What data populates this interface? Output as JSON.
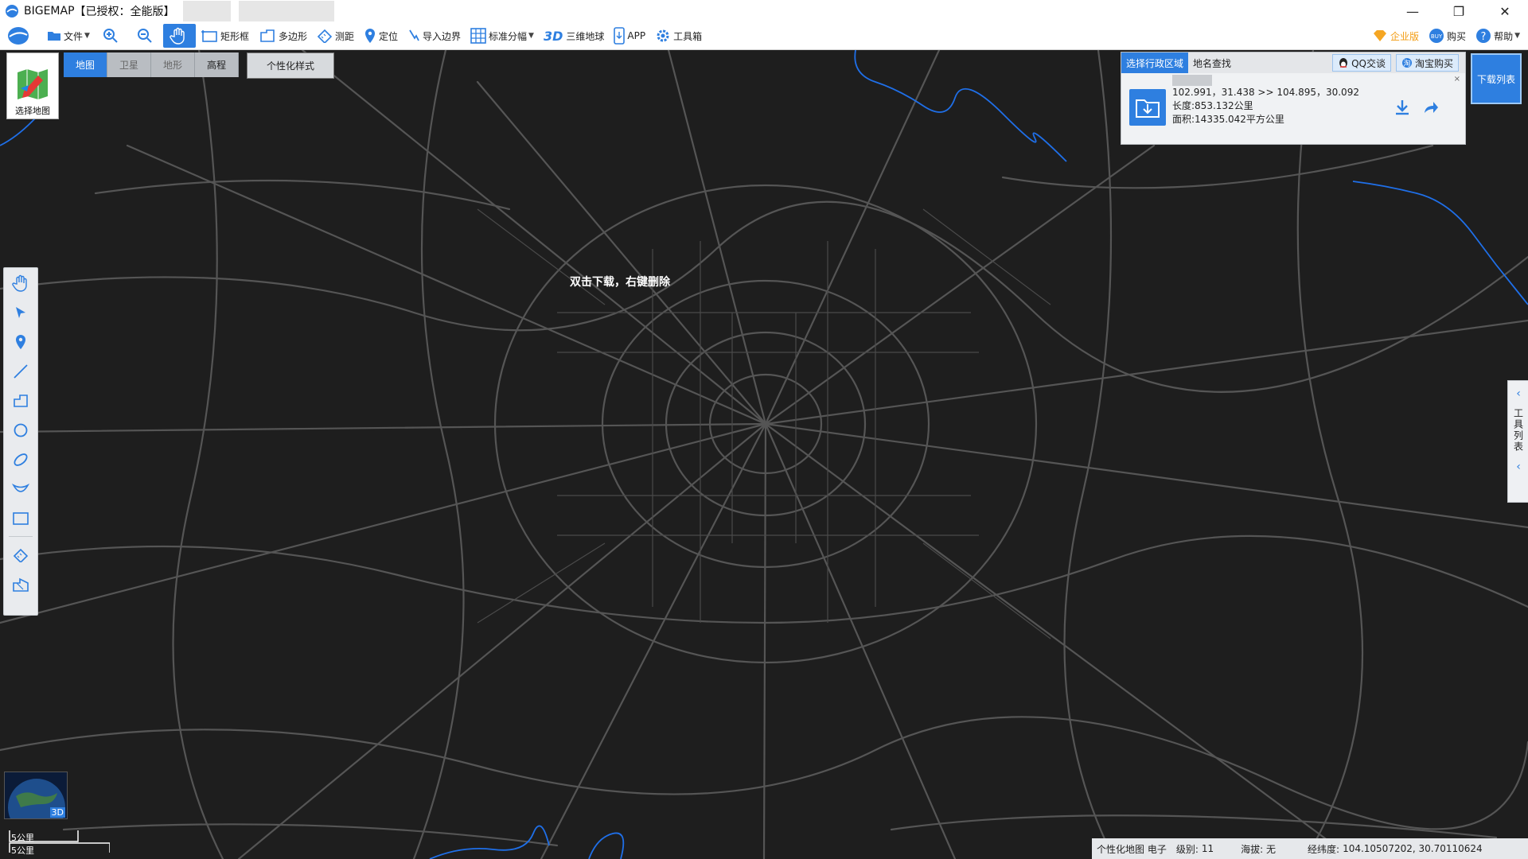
{
  "titlebar": {
    "app_name": "BIGEMAP",
    "license": "【已授权：全能版】",
    "minimize": "—",
    "restore": "❐",
    "close": "✕"
  },
  "toolbar": {
    "file": "文件",
    "rect_select": "矩形框",
    "polygon": "多边形",
    "measure": "测距",
    "locate": "定位",
    "import_boundary": "导入边界",
    "standard_sheet": "标准分幅",
    "threed_label": "3D",
    "globe": "三维地球",
    "app": "APP",
    "toolbox": "工具箱",
    "enterprise": "企业版",
    "buy": "购买",
    "help": "帮助"
  },
  "map_tabs": {
    "map": "地图",
    "satellite": "卫星",
    "terrain": "地形",
    "elevation": "高程",
    "custom_style": "个性化样式"
  },
  "choose_map": "选择地图",
  "region_panel": {
    "tab_admin": "选择行政区域",
    "tab_search": "地名查找",
    "qq": "QQ交谈",
    "taobao": "淘宝购买",
    "coords": "102.991，31.438 >> 104.895，30.092",
    "length": "长度:853.132公里",
    "area": "面积:14335.042平方公里",
    "close": "×"
  },
  "download_list": "下载列表",
  "tool_list": "工具列表",
  "map_hint": "双击下载，右键删除",
  "globe_3d": "3D",
  "scale": {
    "top": "5公里",
    "bottom": "5公里"
  },
  "statusbar": {
    "map_type": "个性化地图 电子",
    "level_label": "级别:",
    "level": "11",
    "altitude": "海拔: 无",
    "lonlat_label": "经纬度:",
    "lonlat": "104.10507202, 30.70110624"
  },
  "colors": {
    "accent": "#2e7fe0",
    "map_bg": "#1e1e1e",
    "road": "#5a5a5a",
    "water": "#1f6fe8"
  }
}
